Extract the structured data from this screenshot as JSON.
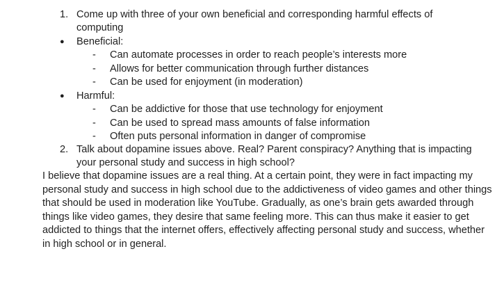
{
  "list": {
    "item1": {
      "marker": "1.",
      "text_line1": "Come up with three of your own beneficial and corresponding harmful effects of",
      "text_line2": "computing"
    },
    "beneficial": {
      "marker": "●",
      "label": "Beneficial:",
      "items": [
        {
          "marker": "-",
          "text": "Can automate processes in order to reach people’s interests more"
        },
        {
          "marker": "-",
          "text": "Allows for better communication through further distances"
        },
        {
          "marker": "-",
          "text": "Can be used for enjoyment (in moderation)"
        }
      ]
    },
    "harmful": {
      "marker": "●",
      "label": "Harmful:",
      "items": [
        {
          "marker": "-",
          "text": "Can be addictive for those that use technology for enjoyment"
        },
        {
          "marker": "-",
          "text": "Can be used to spread mass amounts of false information"
        },
        {
          "marker": "-",
          "text": "Often puts personal information in danger of compromise"
        }
      ]
    },
    "item2": {
      "marker": "2.",
      "text_line1": "Talk about dopamine issues above. Real? Parent conspiracy? Anything that is impacting",
      "text_line2": "your personal study and success in high school?"
    }
  },
  "answer": {
    "paragraph": "I believe that dopamine issues are a real thing. At a certain point, they were in fact impacting my personal study and success in high school due to the addictiveness of video games and other things that should be used in moderation like YouTube. Gradually, as one’s brain gets awarded through things like video games, they desire that same feeling more. This can thus make it easier to get addicted to things that the internet offers, effectively affecting personal study and success, whether in high school or in general."
  }
}
